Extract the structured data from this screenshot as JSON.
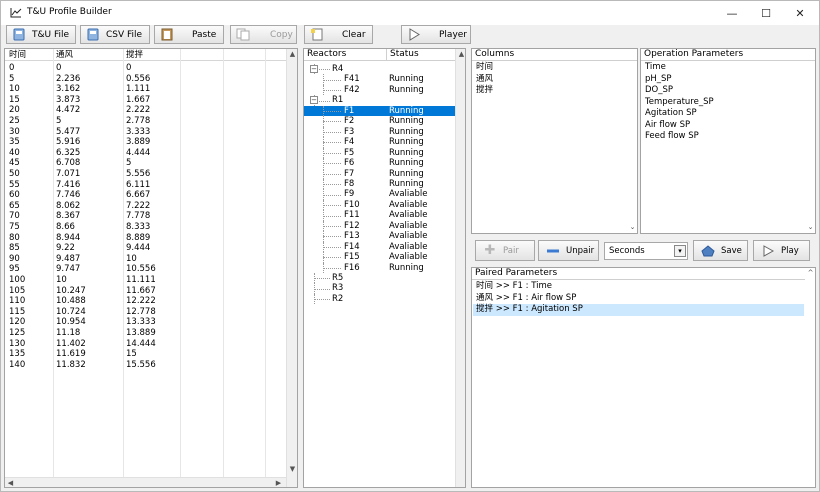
{
  "window": {
    "title": "T&U Profile Builder",
    "controls": [
      "—",
      "☐",
      "✕"
    ]
  },
  "toolbar": {
    "buttons": [
      {
        "label": "T&U File",
        "icon": "database-icon"
      },
      {
        "label": "CSV File",
        "icon": "database-icon"
      },
      {
        "label": "Paste",
        "icon": "clipboard-icon"
      },
      {
        "label": "Copy",
        "icon": "copy-icon"
      },
      {
        "label": "Clear",
        "icon": "page-icon"
      },
      {
        "label": "Player",
        "icon": "play-icon"
      }
    ]
  },
  "data_table": {
    "headers": [
      "时间",
      "通风",
      "搅拌"
    ],
    "rows": [
      [
        "0",
        "0",
        "0"
      ],
      [
        "5",
        "2.236",
        "0.556"
      ],
      [
        "10",
        "3.162",
        "1.111"
      ],
      [
        "15",
        "3.873",
        "1.667"
      ],
      [
        "20",
        "4.472",
        "2.222"
      ],
      [
        "25",
        "5",
        "2.778"
      ],
      [
        "30",
        "5.477",
        "3.333"
      ],
      [
        "35",
        "5.916",
        "3.889"
      ],
      [
        "40",
        "6.325",
        "4.444"
      ],
      [
        "45",
        "6.708",
        "5"
      ],
      [
        "50",
        "7.071",
        "5.556"
      ],
      [
        "55",
        "7.416",
        "6.111"
      ],
      [
        "60",
        "7.746",
        "6.667"
      ],
      [
        "65",
        "8.062",
        "7.222"
      ],
      [
        "70",
        "8.367",
        "7.778"
      ],
      [
        "75",
        "8.66",
        "8.333"
      ],
      [
        "80",
        "8.944",
        "8.889"
      ],
      [
        "85",
        "9.22",
        "9.444"
      ],
      [
        "90",
        "9.487",
        "10"
      ],
      [
        "95",
        "9.747",
        "10.556"
      ],
      [
        "100",
        "10",
        "11.111"
      ],
      [
        "105",
        "10.247",
        "11.667"
      ],
      [
        "110",
        "10.488",
        "12.222"
      ],
      [
        "115",
        "10.724",
        "12.778"
      ],
      [
        "120",
        "10.954",
        "13.333"
      ],
      [
        "125",
        "11.18",
        "13.889"
      ],
      [
        "130",
        "11.402",
        "14.444"
      ],
      [
        "135",
        "11.619",
        "15"
      ],
      [
        "140",
        "11.832",
        "15.556"
      ]
    ]
  },
  "reactors": {
    "headers": [
      "Reactors",
      "Status"
    ],
    "tree": [
      {
        "label": "R4",
        "status": "",
        "level": 0,
        "expander": "−"
      },
      {
        "label": "F41",
        "status": "Running",
        "level": 1
      },
      {
        "label": "F42",
        "status": "Running",
        "level": 1
      },
      {
        "label": "R1",
        "status": "",
        "level": 0,
        "expander": "−"
      },
      {
        "label": "F1",
        "status": "Running",
        "level": 1,
        "selected": true
      },
      {
        "label": "F2",
        "status": "Running",
        "level": 1
      },
      {
        "label": "F3",
        "status": "Running",
        "level": 1
      },
      {
        "label": "F4",
        "status": "Running",
        "level": 1
      },
      {
        "label": "F5",
        "status": "Running",
        "level": 1
      },
      {
        "label": "F6",
        "status": "Running",
        "level": 1
      },
      {
        "label": "F7",
        "status": "Running",
        "level": 1
      },
      {
        "label": "F8",
        "status": "Running",
        "level": 1
      },
      {
        "label": "F9",
        "status": "Avaliable",
        "level": 1
      },
      {
        "label": "F10",
        "status": "Avaliable",
        "level": 1
      },
      {
        "label": "F11",
        "status": "Avaliable",
        "level": 1
      },
      {
        "label": "F12",
        "status": "Avaliable",
        "level": 1
      },
      {
        "label": "F13",
        "status": "Avaliable",
        "level": 1
      },
      {
        "label": "F14",
        "status": "Avaliable",
        "level": 1
      },
      {
        "label": "F15",
        "status": "Avaliable",
        "level": 1
      },
      {
        "label": "F16",
        "status": "Running",
        "level": 1
      },
      {
        "label": "R5",
        "status": "",
        "level": 0
      },
      {
        "label": "R3",
        "status": "",
        "level": 0
      },
      {
        "label": "R2",
        "status": "",
        "level": 0
      }
    ]
  },
  "columns": {
    "header": "Columns",
    "items": [
      "时间",
      "通风",
      "搅拌"
    ]
  },
  "operation_parameters": {
    "header": "Operation Parameters",
    "items": [
      "Time",
      "pH_SP",
      "DO_SP",
      "Temperature_SP",
      "Agitation SP",
      "Air flow SP",
      "Feed flow SP"
    ]
  },
  "pair_controls": {
    "pair_label": "Pair",
    "unpair_label": "Unpair",
    "unit_value": "Seconds",
    "save_label": "Save",
    "play_label": "Play"
  },
  "paired_parameters": {
    "header": "Paired Parameters",
    "items": [
      {
        "text": "时间 >> F1 : Time",
        "selected": false
      },
      {
        "text": "通风 >> F1 : Air flow SP",
        "selected": false
      },
      {
        "text": "搅拌 >> F1 : Agitation SP",
        "selected": true
      }
    ]
  },
  "colors": {
    "selection": "#0078d7",
    "selection_light": "#cce8ff"
  }
}
